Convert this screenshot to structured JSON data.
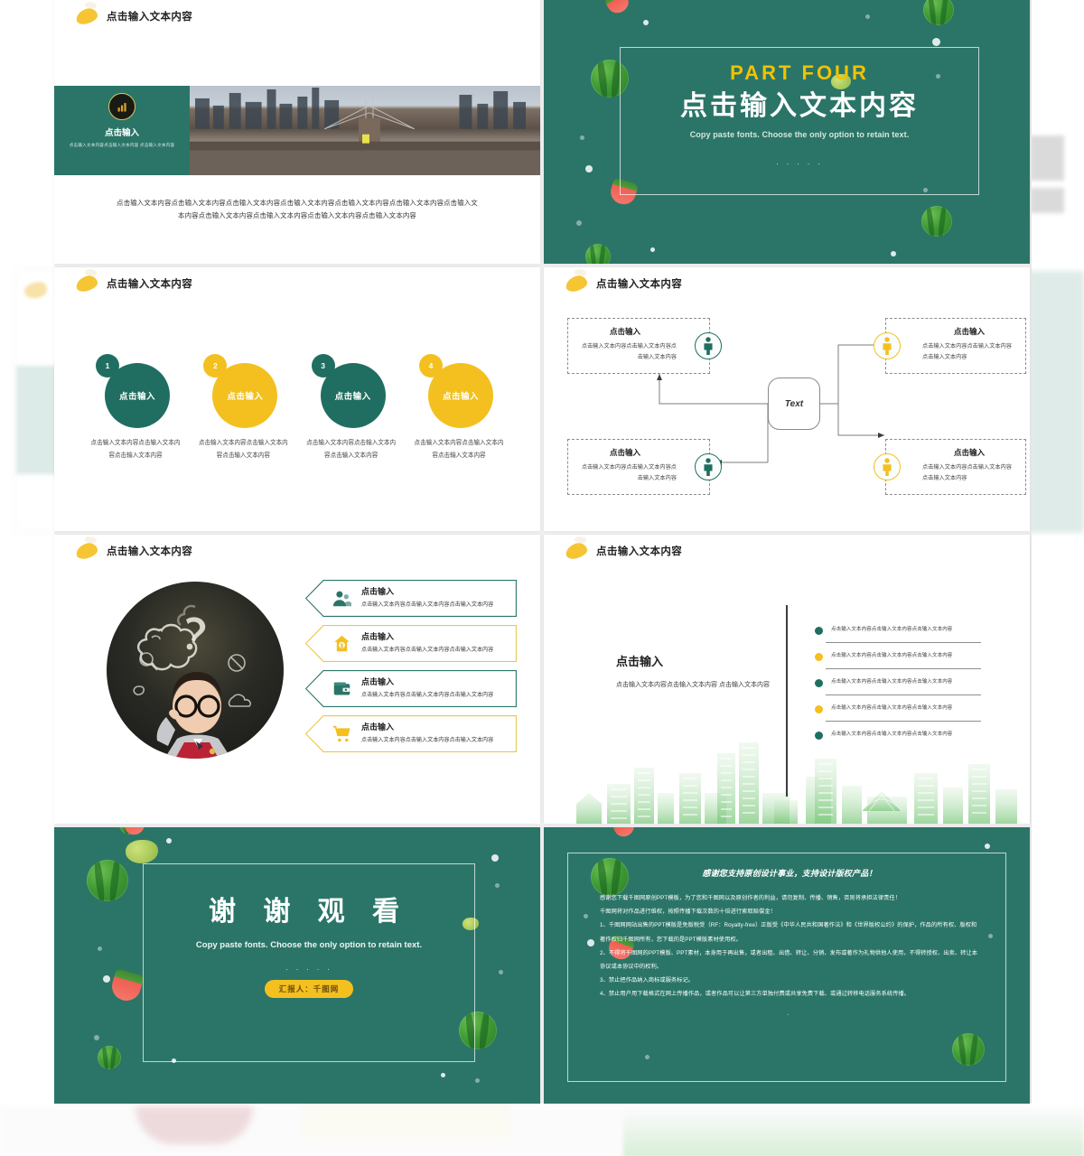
{
  "theme": {
    "green": "#2b7568",
    "yellow": "#f3c01f",
    "teal": "#2b7568",
    "accent_yellow_text": "#f2c200"
  },
  "common": {
    "header_title": "点击输入文本内容",
    "leaf_icon": "leaf-icon",
    "click_input": "点击输入",
    "dots": "· · · · ·"
  },
  "slides": [
    {
      "id": "slide-image-banner",
      "header": "点击输入文本内容",
      "banner_card": {
        "logo_icon": "bar-chart-icon",
        "title": "点击输入",
        "subtitle": "点击输入文本内容点击输入文本内容\n点击输入文本内容"
      },
      "caption": "点击输入文本内容点击输入文本内容点击输入文本内容点击输入文本内容点击输入文本内容点击输入文本内容点击输入文本内容点击输入文本内容点击输入文本内容点击输入文本内容点击输入文本内容"
    },
    {
      "id": "slide-part-four",
      "part_label": "PART  FOUR",
      "title": "点击输入文本内容",
      "subtitle": "Copy paste fonts. Choose the only option to retain text.",
      "dots": "· · · · ·"
    },
    {
      "id": "slide-four-circles",
      "header": "点击输入文本内容",
      "items": [
        {
          "num": "1",
          "label": "点击输入",
          "color": "#1f6e61",
          "desc": "点击输入文本内容点击输入文本内容点击输入文本内容"
        },
        {
          "num": "2",
          "label": "点击输入",
          "color": "#f3c01f",
          "desc": "点击输入文本内容点击输入文本内容点击输入文本内容"
        },
        {
          "num": "3",
          "label": "点击输入",
          "color": "#1f6e61",
          "desc": "点击输入文本内容点击输入文本内容点击输入文本内容"
        },
        {
          "num": "4",
          "label": "点击输入",
          "color": "#f3c01f",
          "desc": "点击输入文本内容点击输入文本内容点击输入文本内容"
        }
      ]
    },
    {
      "id": "slide-flow-diagram",
      "header": "点击输入文本内容",
      "hub_label": "Text",
      "boxes": [
        {
          "pos": "top-left",
          "title": "点击输入",
          "desc": "点击输入文本内容点击输入文本内容点击输入文本内容",
          "icon": "person-icon",
          "color": "#1f6e61"
        },
        {
          "pos": "top-right",
          "title": "点击输入",
          "desc": "点击输入文本内容点击输入文本内容点击输入文本内容",
          "icon": "person-icon",
          "color": "#f3c01f"
        },
        {
          "pos": "bottom-left",
          "title": "点击输入",
          "desc": "点击输入文本内容点击输入文本内容点击输入文本内容",
          "icon": "person-icon",
          "color": "#1f6e61"
        },
        {
          "pos": "bottom-right",
          "title": "点击输入",
          "desc": "点击输入文本内容点击输入文本内容点击输入文本内容",
          "icon": "person-icon",
          "color": "#f3c01f"
        }
      ]
    },
    {
      "id": "slide-photo-banners",
      "header": "点击输入文本内容",
      "photo_alt": "boy-thinking-chalkboard-photo",
      "banners": [
        {
          "title": "点击输入",
          "desc": "点击输入文本内容点击输入文本内容点击输入文本内容",
          "icon": "users-icon",
          "color": "#1f6e61"
        },
        {
          "title": "点击输入",
          "desc": "点击输入文本内容点击输入文本内容点击输入文本内容",
          "icon": "house-money-icon",
          "color": "#f3c01f"
        },
        {
          "title": "点击输入",
          "desc": "点击输入文本内容点击输入文本内容点击输入文本内容",
          "icon": "wallet-icon",
          "color": "#1f6e61"
        },
        {
          "title": "点击输入",
          "desc": "点击输入文本内容点击输入文本内容点击输入文本内容",
          "icon": "shopping-cart-icon",
          "color": "#f3c01f"
        }
      ]
    },
    {
      "id": "slide-city-timeline",
      "header": "点击输入文本内容",
      "heading": "点击输入",
      "paragraph": "点击输入文本内容点击输入文本内容\n点击输入文本内容",
      "timeline": [
        {
          "text": "点击输入文本内容点击输入文本内容点击输入文本内容",
          "color": "#1f6e61"
        },
        {
          "text": "点击输入文本内容点击输入文本内容点击输入文本内容",
          "color": "#f3c01f"
        },
        {
          "text": "点击输入文本内容点击输入文本内容点击输入文本内容",
          "color": "#1f6e61"
        },
        {
          "text": "点击输入文本内容点击输入文本内容点击输入文本内容",
          "color": "#f3c01f"
        },
        {
          "text": "点击输入文本内容点击输入文本内容点击输入文本内容",
          "color": "#1f6e61"
        }
      ]
    },
    {
      "id": "slide-thank-you",
      "title": "谢 谢 观 看",
      "subtitle": "Copy paste fonts. Choose the only option to retain text.",
      "dots": "· · · · ·",
      "presenter_pill": "汇报人：千图网"
    },
    {
      "id": "slide-copyright",
      "title": "感谢您支持原创设计事业，支持设计版权产品！",
      "paragraphs": [
        "感谢您下载千图网原创PPT模板，为了您和千图网以及原创作者的利益，请勿复制、传播、销售，否则将承担法律责任！",
        "千图网将对作品进行维权，按照传播下载次数的十倍进行索取赔偿金！",
        "1、千图网网站出售的PPT模版是免版税受（RF：Royalty-free）正版受《中华人民共和国著作法》和《世界版权公约》的保护，作品的所有权、版权和著作权归千图网所有，您下载的是PPT模版素材使用权。",
        "2、不得将千图网的PPT模版、PPT素材，本身用于再出售，或者出租、出借、转让、分销、发布或著作为礼物供他人使用，不得转授权、出卖、转让本协议或本协议中的权利。",
        "3、禁止把作品纳入商标或服务标记。",
        "4、禁止用户用下载格式在网上传播作品，或者作品可以让第三方单独付费或共享免费下载、或通过转移电话服务系统传播。"
      ],
      "dots": "·"
    }
  ]
}
